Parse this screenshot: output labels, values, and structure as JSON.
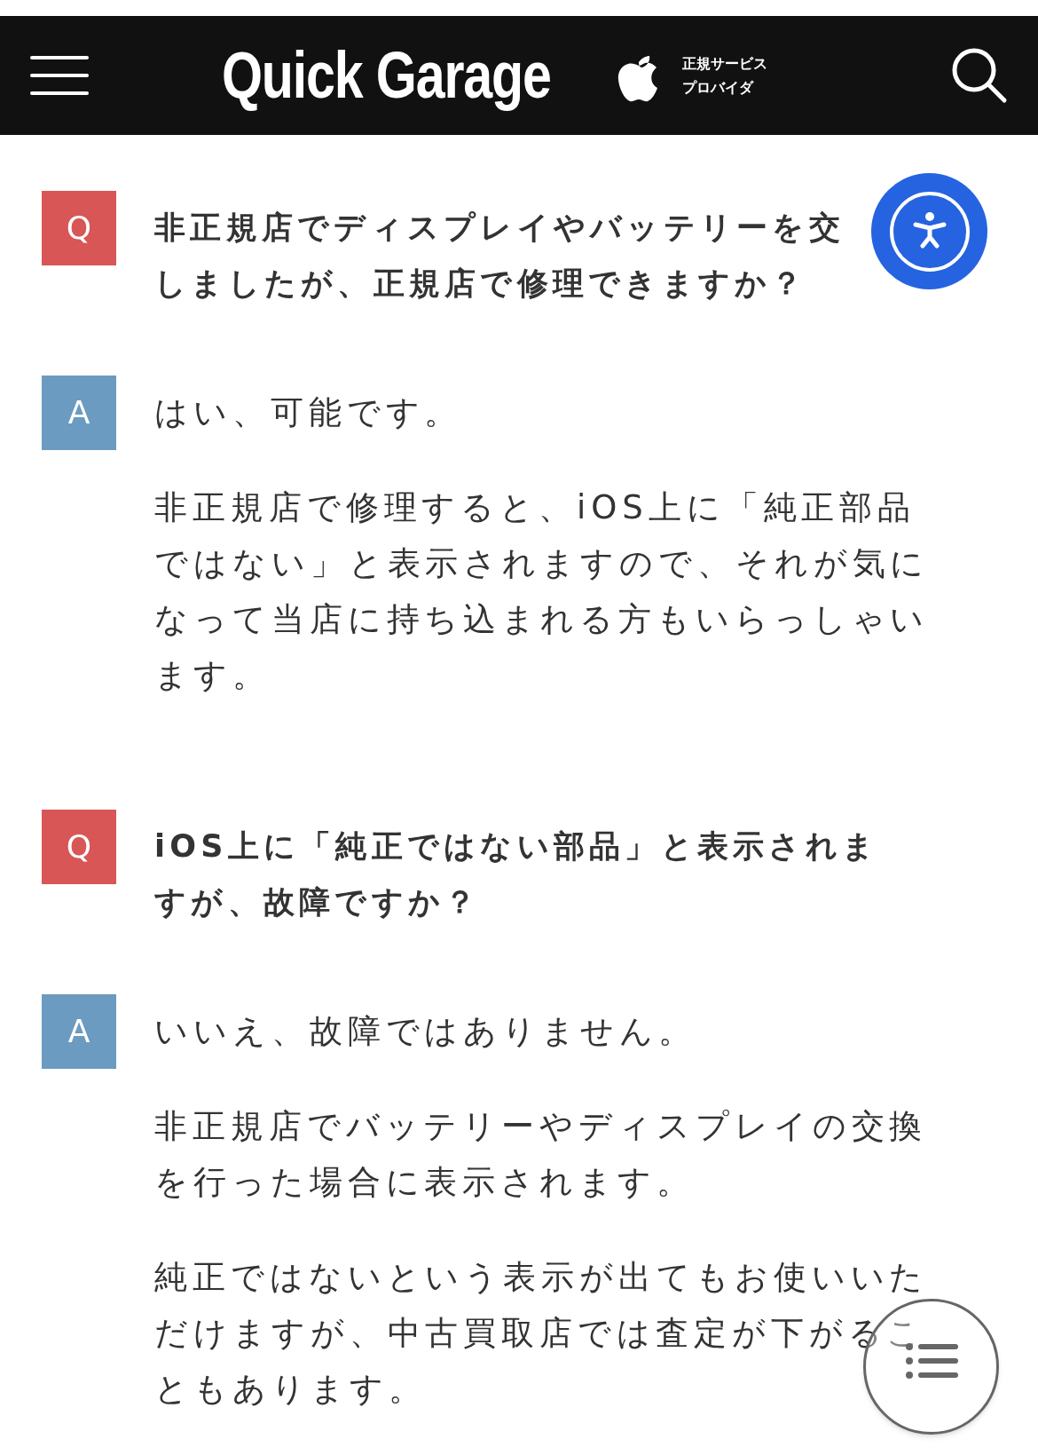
{
  "header": {
    "logo": "Quick Garage",
    "badge_lines": [
      "正規サービス",
      "プロバイダ"
    ]
  },
  "faq": [
    {
      "question": {
        "label": "Q",
        "lines": [
          "非正規店でディスプレイやバッテリーを交",
          "しましたが、正規店で修理できますか？"
        ]
      },
      "answer": {
        "label": "A",
        "paragraphs": [
          [
            "はい、可能です。"
          ],
          [
            "非正規店で修理すると、iOS上に「純正部品",
            "ではない」と表示されますので、それが気に",
            "なって当店に持ち込まれる方もいらっしゃい",
            "ます。"
          ]
        ]
      }
    },
    {
      "question": {
        "label": "Q",
        "lines": [
          "iOS上に「純正ではない部品」と表示されま",
          "すが、故障ですか？"
        ]
      },
      "answer": {
        "label": "A",
        "paragraphs": [
          [
            "いいえ、故障ではありません。"
          ],
          [
            "非正規店でバッテリーやディスプレイの交換",
            "を行った場合に表示されます。"
          ],
          [
            "純正ではないという表示が出てもお使いいた",
            "だけますが、中古買取店では査定が下がるこ",
            "ともあります。"
          ]
        ]
      }
    }
  ]
}
